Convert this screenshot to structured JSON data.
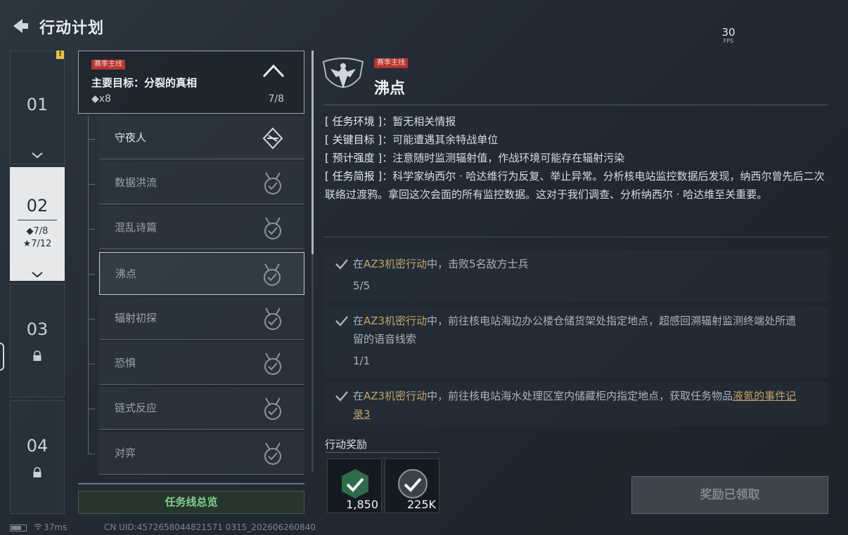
{
  "header": {
    "title": "行动计划",
    "fps_value": "30",
    "fps_unit": "FPS"
  },
  "chapters": [
    {
      "num": "01",
      "alert": "!"
    },
    {
      "num": "02",
      "stat_diamond": "◆7/8",
      "stat_star": "★7/12"
    },
    {
      "num": "03",
      "locked": true
    },
    {
      "num": "04",
      "locked": true
    }
  ],
  "mission_header": {
    "tag": "赛季主线",
    "title": "主要目标：分裂的真相",
    "count": "◆x8",
    "progress": "7/8"
  },
  "missions": [
    "守夜人",
    "数据洪流",
    "混乱诗篇",
    "沸点",
    "辐射初探",
    "恐惧",
    "链式反应",
    "对弈"
  ],
  "overview_button": "任务线总览",
  "detail": {
    "tag": "赛季主线",
    "title": "沸点",
    "env_key": "[ 任务环境 ]",
    "env_val": "：暂无相关情报",
    "target_key": "[ 关键目标 ]",
    "target_val": "：可能遭遇其余特战单位",
    "strength_key": "[ 预计强度 ]",
    "strength_val": "：注意随时监测辐射值，作战环境可能存在辐射污染",
    "brief_key": "[ 任务简报 ]",
    "brief_val": "：科学家纳西尔 · 哈达维行为反复、举止异常。分析核电站监控数据后发现，纳西尔曾先后二次联络过渡鸦。拿回这次会面的所有监控数据。这对于我们调查、分析纳西尔 · 哈达维至关重要。"
  },
  "objectives": [
    {
      "pre": "在",
      "hl": "AZ3机密行动",
      "post": "中，击败5名敌方士兵",
      "progress": "5/5"
    },
    {
      "pre": "在",
      "hl": "AZ3机密行动",
      "post": "中，前往核电站海边办公楼仓储货架处指定地点，超感回溯辐射监测终端处所遗留的语音线索",
      "progress": "1/1"
    },
    {
      "pre": "在",
      "hl": "AZ3机密行动",
      "post": "中，前往核电站海水处理区室内储藏柜内指定地点，获取任务物品",
      "link": "液氮的事件记录3"
    }
  ],
  "rewards": {
    "label": "行动奖励",
    "items": [
      {
        "amount": "1,850"
      },
      {
        "amount": "225K"
      }
    ]
  },
  "claim_button": "奖励已领取",
  "status_bar": {
    "ping": "37ms",
    "uid": "CN UID:4572658044821571 0315_202606260840"
  }
}
